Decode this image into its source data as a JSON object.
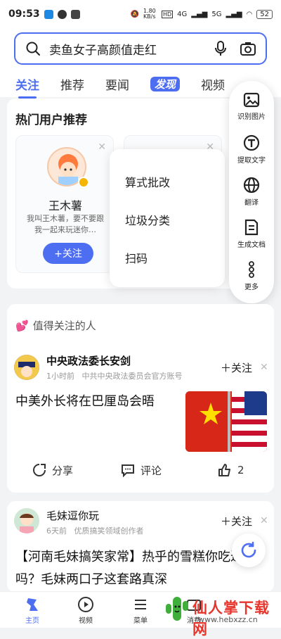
{
  "status_bar": {
    "time": "09:53",
    "net_speed": "1.80 KB/s",
    "network_4g": "4G",
    "network_5g": "5G",
    "battery": "52"
  },
  "search": {
    "query": "卖鱼女子高颜值走红"
  },
  "tabs": [
    {
      "label": "关注"
    },
    {
      "label": "推荐"
    },
    {
      "label": "要闻"
    },
    {
      "label": "发现"
    },
    {
      "label": "视频"
    }
  ],
  "recommend": {
    "title": "热门用户推荐",
    "users": [
      {
        "name": "王木薯",
        "desc": "我叫王木薯，要不要跟我一起来玩迷你…",
        "follow_label": "+关注"
      }
    ]
  },
  "popup_menu": {
    "items": [
      "算式批改",
      "垃圾分类",
      "扫码"
    ]
  },
  "side_menu": {
    "items": [
      {
        "label": "识别图片",
        "icon": "image-icon"
      },
      {
        "label": "提取文字",
        "icon": "text-extract-icon"
      },
      {
        "label": "翻译",
        "icon": "globe-icon"
      },
      {
        "label": "生成文档",
        "icon": "document-icon"
      },
      {
        "label": "更多",
        "icon": "more-icon"
      }
    ]
  },
  "follow_section": {
    "title": "值得关注的人",
    "post": {
      "author": "中央政法委长安剑",
      "time": "1小时前",
      "source": "中共中央政法委员会官方账号",
      "follow_label": "关注",
      "headline": "中美外长将在巴厘岛会晤",
      "share_label": "分享",
      "comment_label": "评论",
      "like_count": "2"
    }
  },
  "post2": {
    "author": "毛妹逗你玩",
    "time": "6天前",
    "source": "优质搞笑领域创作者",
    "follow_label": "关注",
    "headline": "【河南毛妹搞笑家常】热乎的雪糕你吃过吗？毛妹两口子这套路真深"
  },
  "bottom_nav": {
    "items": [
      {
        "label": "主页"
      },
      {
        "label": "视频"
      },
      {
        "label": "菜单"
      },
      {
        "label": "消费"
      }
    ]
  },
  "watermark": {
    "text": "仙人掌下载网",
    "url": "www.hebxzz.cn"
  },
  "colors": {
    "accent": "#4e6ef2",
    "background": "#f2f3f5"
  }
}
